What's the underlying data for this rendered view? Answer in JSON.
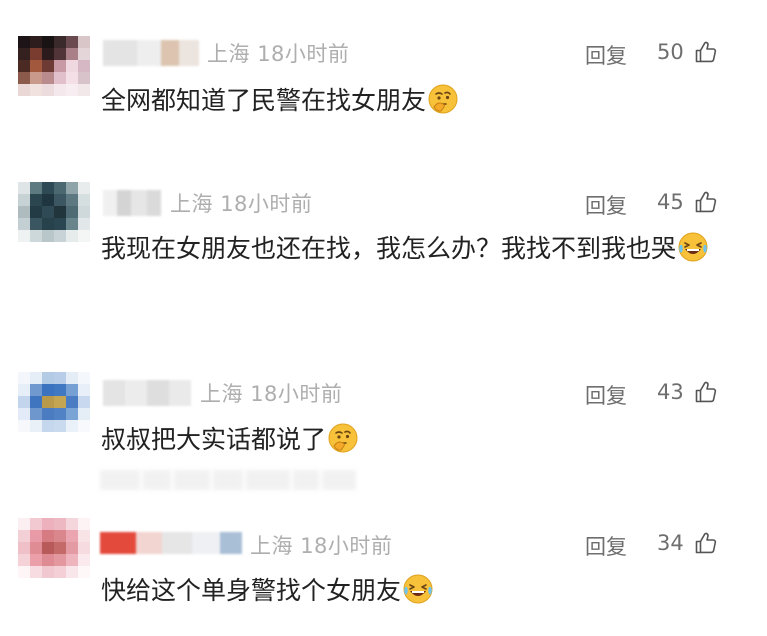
{
  "comments": [
    {
      "location": "上海",
      "time": "18小时前",
      "reply_label": "回复",
      "likes": "50",
      "text": "全网都知道了民警在找女朋友",
      "emoji": "thinking-emoji"
    },
    {
      "location": "上海",
      "time": "18小时前",
      "reply_label": "回复",
      "likes": "45",
      "text": "我现在女朋友也还在找，我怎么办？我找不到我也哭",
      "emoji": "laughing-tears-emoji"
    },
    {
      "location": "上海",
      "time": "18小时前",
      "reply_label": "回复",
      "likes": "43",
      "text": "叔叔把大实话都说了",
      "emoji": "thinking-emoji"
    },
    {
      "location": "上海",
      "time": "18小时前",
      "reply_label": "回复",
      "likes": "34",
      "text": "快给这个单身警找个女朋友",
      "emoji": "laughing-tears-emoji"
    }
  ],
  "colors": {
    "text": "#222222",
    "meta": "#aeaeae",
    "action": "#6e6e6e",
    "emoji_face": "#f7c23a"
  }
}
